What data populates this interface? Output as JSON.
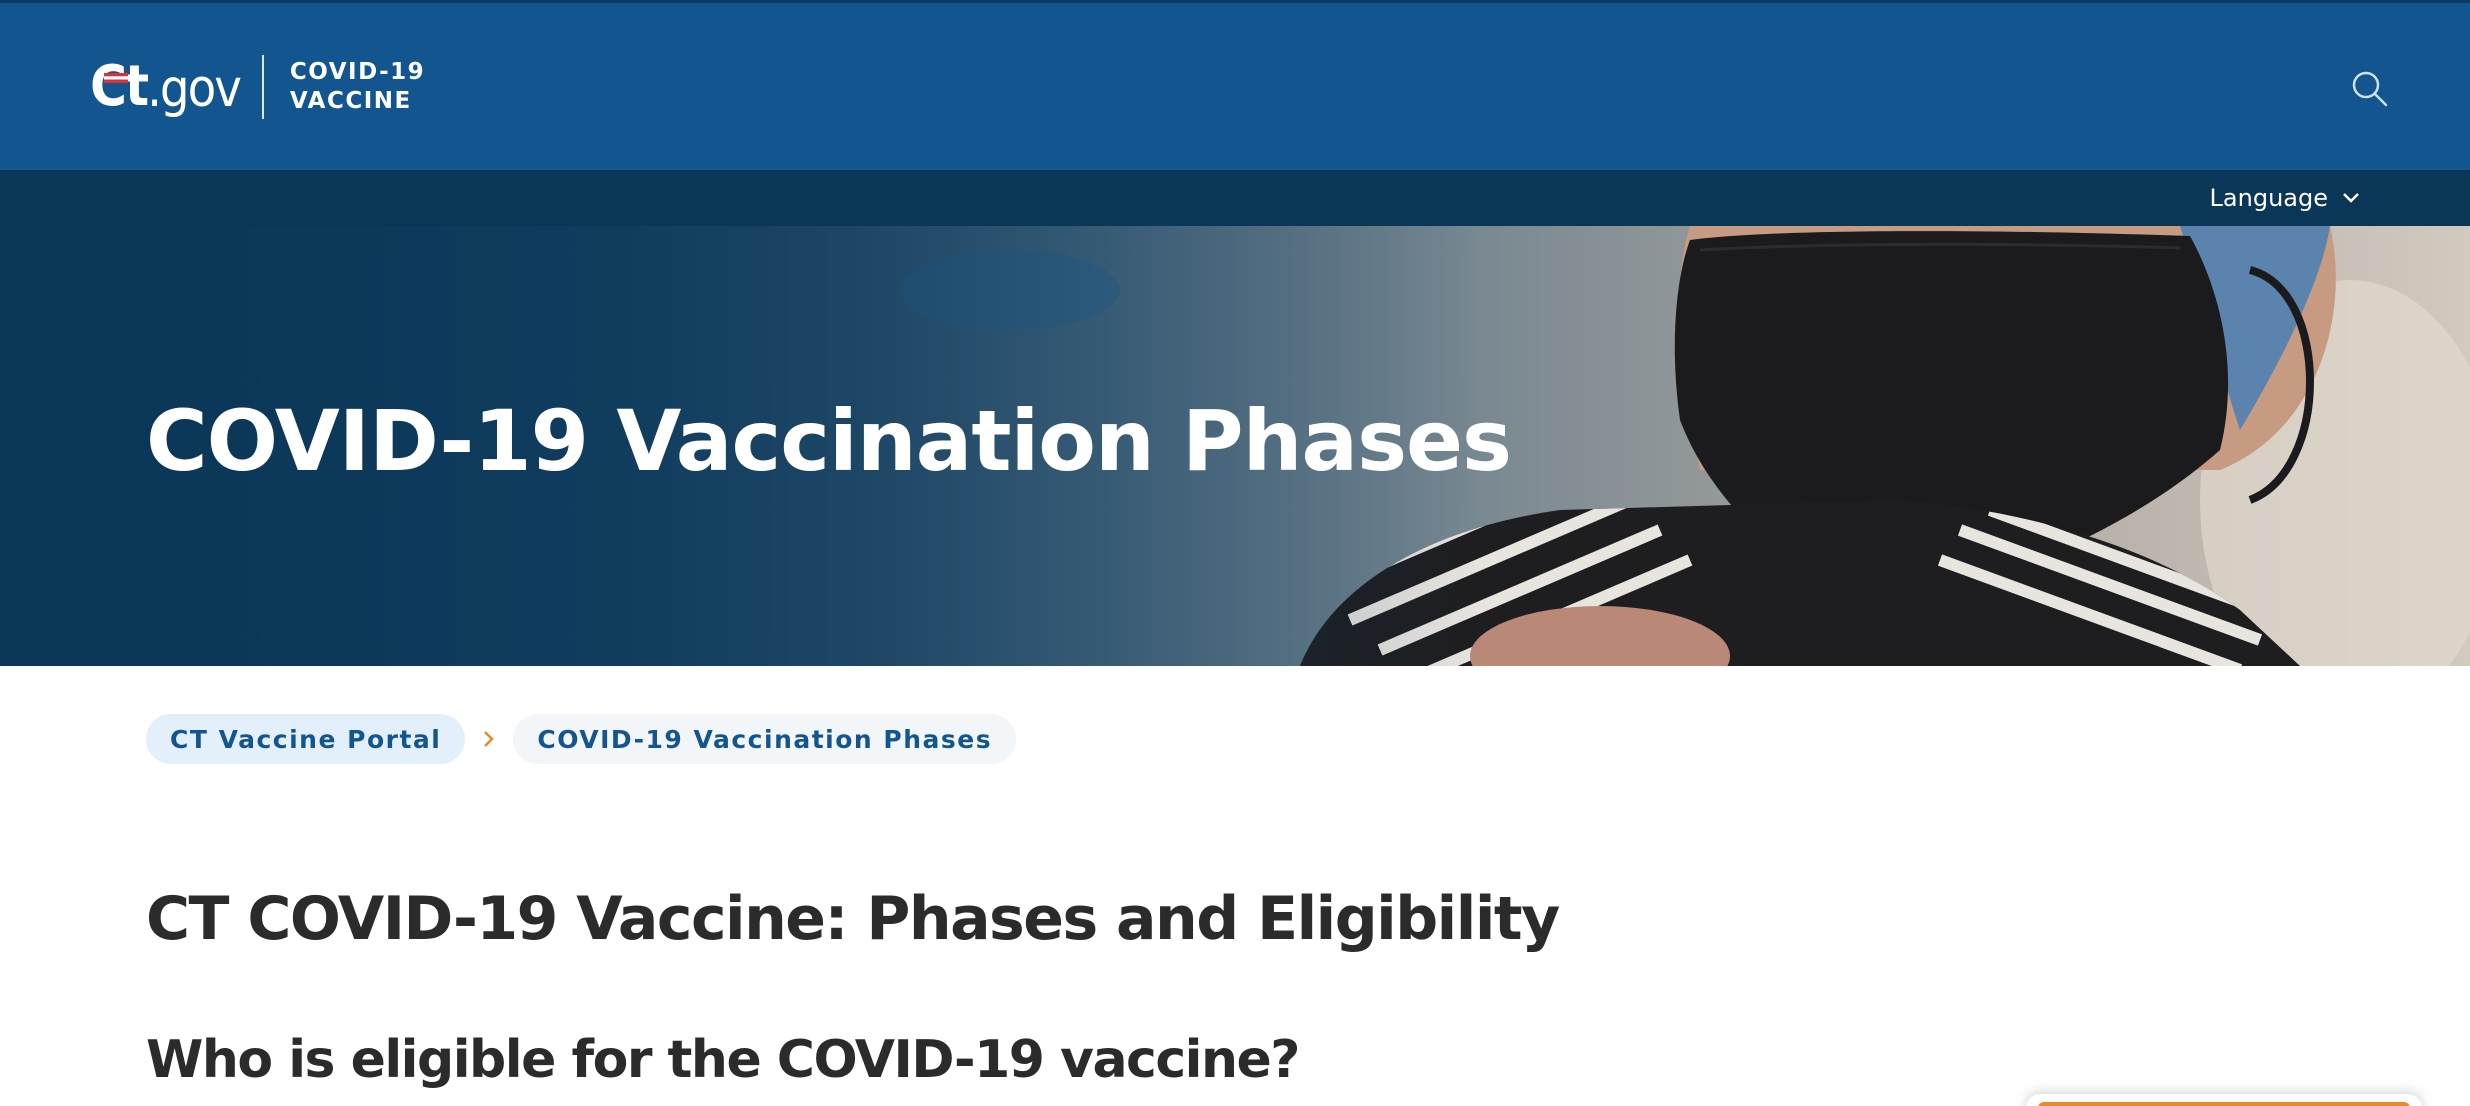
{
  "header": {
    "logo": {
      "mark_primary": "Ct",
      "mark_secondary": ".gov",
      "text_line1": "COVID-19",
      "text_line2": "VACCINE"
    },
    "search_icon": "search-icon"
  },
  "language": {
    "label": "Language",
    "icon": "chevron-down-icon"
  },
  "hero": {
    "title": "COVID-19 Vaccination Phases"
  },
  "breadcrumb": {
    "items": [
      {
        "label": "CT Vaccine Portal"
      },
      {
        "label": "COVID-19 Vaccination Phases"
      }
    ],
    "separator_icon": "chevron-right-icon"
  },
  "main": {
    "heading": "CT COVID-19 Vaccine: Phases and Eligibility",
    "section_heading": "Who is eligible for the COVID-19 vaccine?"
  },
  "colors": {
    "header_bg": "#13568f",
    "language_bar_bg": "#0a3657",
    "breadcrumb_text": "#13568f",
    "breadcrumb_link_bg": "#e3f0fb",
    "breadcrumb_separator": "#e8892b",
    "heading_text": "#2b2b2b",
    "accent_orange": "#e8892b"
  }
}
